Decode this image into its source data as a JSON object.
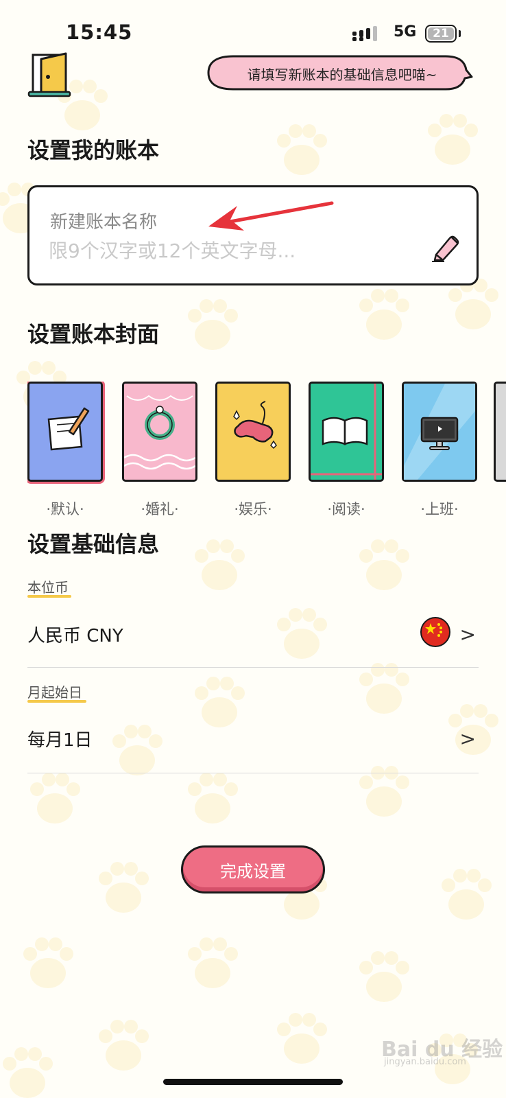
{
  "status_bar": {
    "time": "15:45",
    "network": "5G",
    "battery": "21"
  },
  "header": {
    "bubble_text": "请填写新账本的基础信息吧喵~"
  },
  "name_section": {
    "title": "设置我的账本",
    "label": "新建账本名称",
    "placeholder": "限9个汉字或12个英文字母..."
  },
  "cover_section": {
    "title": "设置账本封面",
    "covers": [
      {
        "label": "·默认·",
        "color": "#8aa4f0",
        "icon": "note-pen-icon",
        "selected": true
      },
      {
        "label": "·婚礼·",
        "color": "#f8b8cc",
        "icon": "wreath-icon",
        "selected": false
      },
      {
        "label": "·娱乐·",
        "color": "#f7cf5a",
        "icon": "gamepad-icon",
        "selected": false
      },
      {
        "label": "·阅读·",
        "color": "#2fc596",
        "icon": "open-book-icon",
        "selected": false
      },
      {
        "label": "·上班·",
        "color": "#7ec9ef",
        "icon": "monitor-icon",
        "selected": false
      }
    ]
  },
  "info_section": {
    "title": "设置基础信息",
    "currency": {
      "label": "本位币",
      "value": "人民币 CNY",
      "flag_icon": "china-flag-icon"
    },
    "month_start": {
      "label": "月起始日",
      "value": "每月1日"
    }
  },
  "done_button": "完成设置",
  "watermark": {
    "main": "Bai du 经验",
    "sub": "jingyan.baidu.com"
  },
  "colors": {
    "accent_pink": "#ee6d84",
    "underline_yellow": "#f5c94a",
    "bubble_pink": "#f9c3d0"
  }
}
